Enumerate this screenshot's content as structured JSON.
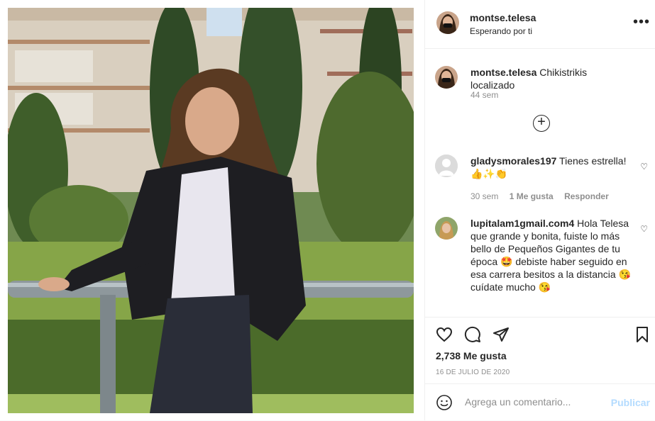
{
  "post": {
    "author": "montse.telesa",
    "location": "Esperando por ti",
    "more_icon": "more-horizontal-icon"
  },
  "caption": {
    "username": "montse.telesa",
    "text": "Chikistrikis localizado",
    "time": "44 sem"
  },
  "load_more_icon": "plus-circle-icon",
  "comments": [
    {
      "username": "gladysmorales197",
      "text": "Tienes estrella! 👍✨👏",
      "time": "30 sem",
      "likes": "1 Me gusta",
      "reply": "Responder"
    },
    {
      "username": "lupitalam1gmail.com4",
      "text": "Hola Telesa que grande y bonita, fuiste lo más bello de Pequeños Gigantes de tu época 🤩 debiste haber seguido en esa carrera besitos a la distancia 😘 cuídate mucho 😘"
    }
  ],
  "actions": {
    "like_icon": "heart-icon",
    "comment_icon": "comment-icon",
    "share_icon": "paper-plane-icon",
    "save_icon": "bookmark-icon"
  },
  "likes_count": "2,738 Me gusta",
  "date": "16 DE JULIO DE 2020",
  "add_comment": {
    "placeholder": "Agrega un comentario...",
    "publish": "Publicar",
    "emoji_icon": "smiley-icon"
  },
  "colors": {
    "link_disabled": "#b3dbff",
    "secondary_text": "#8e8e8e",
    "border": "#efefef"
  }
}
